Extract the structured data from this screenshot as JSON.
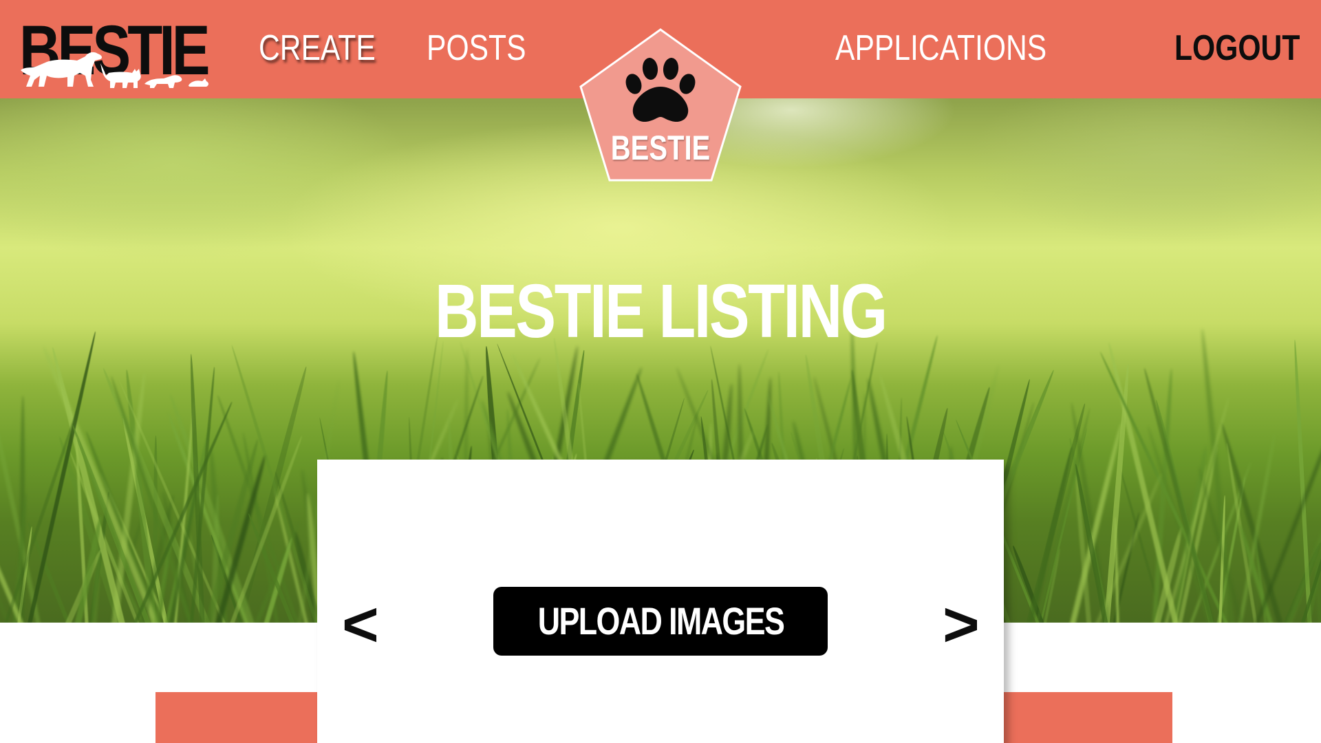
{
  "header": {
    "brand": "BESTIE",
    "nav": {
      "create": "CREATE",
      "posts": "POSTS",
      "applications": "APPLICATIONS",
      "logout": "LOGOUT"
    },
    "badge_label": "BESTIE"
  },
  "hero": {
    "title": "BESTIE LISTING"
  },
  "upload_card": {
    "prev_arrow": "<",
    "next_arrow": ">",
    "upload_button": "UPLOAD IMAGES"
  },
  "icons": {
    "brand_animals": "dog-cat-ferret-mouse-silhouettes-icon",
    "badge": "paw-print-icon"
  },
  "colors": {
    "header_bg": "#eb6f5a",
    "badge_fill": "#f19a8e",
    "button_bg": "#000000",
    "text_dark": "#0d0d0d"
  }
}
